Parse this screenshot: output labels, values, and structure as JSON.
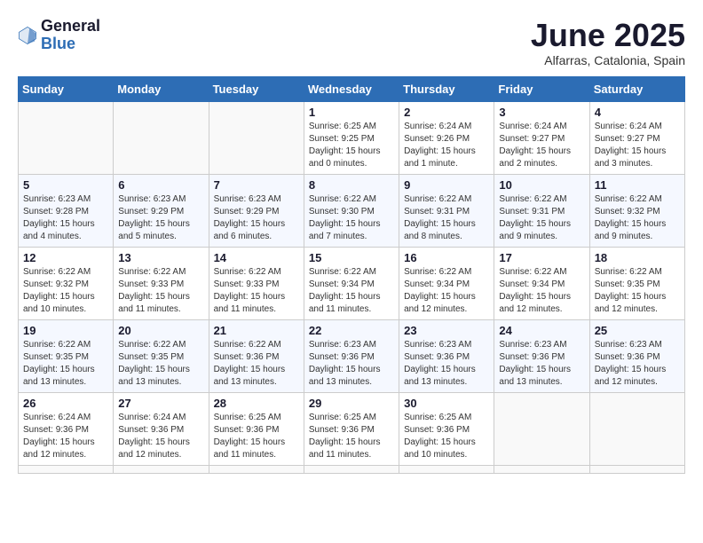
{
  "logo": {
    "general": "General",
    "blue": "Blue"
  },
  "header": {
    "month": "June 2025",
    "location": "Alfarras, Catalonia, Spain"
  },
  "weekdays": [
    "Sunday",
    "Monday",
    "Tuesday",
    "Wednesday",
    "Thursday",
    "Friday",
    "Saturday"
  ],
  "days": [
    {
      "num": "",
      "sunrise": "",
      "sunset": "",
      "daylight": ""
    },
    {
      "num": "",
      "sunrise": "",
      "sunset": "",
      "daylight": ""
    },
    {
      "num": "",
      "sunrise": "",
      "sunset": "",
      "daylight": ""
    },
    {
      "num": "1",
      "sunrise": "Sunrise: 6:25 AM",
      "sunset": "Sunset: 9:25 PM",
      "daylight": "Daylight: 15 hours and 0 minutes."
    },
    {
      "num": "2",
      "sunrise": "Sunrise: 6:24 AM",
      "sunset": "Sunset: 9:26 PM",
      "daylight": "Daylight: 15 hours and 1 minute."
    },
    {
      "num": "3",
      "sunrise": "Sunrise: 6:24 AM",
      "sunset": "Sunset: 9:27 PM",
      "daylight": "Daylight: 15 hours and 2 minutes."
    },
    {
      "num": "4",
      "sunrise": "Sunrise: 6:24 AM",
      "sunset": "Sunset: 9:27 PM",
      "daylight": "Daylight: 15 hours and 3 minutes."
    },
    {
      "num": "5",
      "sunrise": "Sunrise: 6:23 AM",
      "sunset": "Sunset: 9:28 PM",
      "daylight": "Daylight: 15 hours and 4 minutes."
    },
    {
      "num": "6",
      "sunrise": "Sunrise: 6:23 AM",
      "sunset": "Sunset: 9:29 PM",
      "daylight": "Daylight: 15 hours and 5 minutes."
    },
    {
      "num": "7",
      "sunrise": "Sunrise: 6:23 AM",
      "sunset": "Sunset: 9:29 PM",
      "daylight": "Daylight: 15 hours and 6 minutes."
    },
    {
      "num": "8",
      "sunrise": "Sunrise: 6:22 AM",
      "sunset": "Sunset: 9:30 PM",
      "daylight": "Daylight: 15 hours and 7 minutes."
    },
    {
      "num": "9",
      "sunrise": "Sunrise: 6:22 AM",
      "sunset": "Sunset: 9:31 PM",
      "daylight": "Daylight: 15 hours and 8 minutes."
    },
    {
      "num": "10",
      "sunrise": "Sunrise: 6:22 AM",
      "sunset": "Sunset: 9:31 PM",
      "daylight": "Daylight: 15 hours and 9 minutes."
    },
    {
      "num": "11",
      "sunrise": "Sunrise: 6:22 AM",
      "sunset": "Sunset: 9:32 PM",
      "daylight": "Daylight: 15 hours and 9 minutes."
    },
    {
      "num": "12",
      "sunrise": "Sunrise: 6:22 AM",
      "sunset": "Sunset: 9:32 PM",
      "daylight": "Daylight: 15 hours and 10 minutes."
    },
    {
      "num": "13",
      "sunrise": "Sunrise: 6:22 AM",
      "sunset": "Sunset: 9:33 PM",
      "daylight": "Daylight: 15 hours and 11 minutes."
    },
    {
      "num": "14",
      "sunrise": "Sunrise: 6:22 AM",
      "sunset": "Sunset: 9:33 PM",
      "daylight": "Daylight: 15 hours and 11 minutes."
    },
    {
      "num": "15",
      "sunrise": "Sunrise: 6:22 AM",
      "sunset": "Sunset: 9:34 PM",
      "daylight": "Daylight: 15 hours and 11 minutes."
    },
    {
      "num": "16",
      "sunrise": "Sunrise: 6:22 AM",
      "sunset": "Sunset: 9:34 PM",
      "daylight": "Daylight: 15 hours and 12 minutes."
    },
    {
      "num": "17",
      "sunrise": "Sunrise: 6:22 AM",
      "sunset": "Sunset: 9:34 PM",
      "daylight": "Daylight: 15 hours and 12 minutes."
    },
    {
      "num": "18",
      "sunrise": "Sunrise: 6:22 AM",
      "sunset": "Sunset: 9:35 PM",
      "daylight": "Daylight: 15 hours and 12 minutes."
    },
    {
      "num": "19",
      "sunrise": "Sunrise: 6:22 AM",
      "sunset": "Sunset: 9:35 PM",
      "daylight": "Daylight: 15 hours and 13 minutes."
    },
    {
      "num": "20",
      "sunrise": "Sunrise: 6:22 AM",
      "sunset": "Sunset: 9:35 PM",
      "daylight": "Daylight: 15 hours and 13 minutes."
    },
    {
      "num": "21",
      "sunrise": "Sunrise: 6:22 AM",
      "sunset": "Sunset: 9:36 PM",
      "daylight": "Daylight: 15 hours and 13 minutes."
    },
    {
      "num": "22",
      "sunrise": "Sunrise: 6:23 AM",
      "sunset": "Sunset: 9:36 PM",
      "daylight": "Daylight: 15 hours and 13 minutes."
    },
    {
      "num": "23",
      "sunrise": "Sunrise: 6:23 AM",
      "sunset": "Sunset: 9:36 PM",
      "daylight": "Daylight: 15 hours and 13 minutes."
    },
    {
      "num": "24",
      "sunrise": "Sunrise: 6:23 AM",
      "sunset": "Sunset: 9:36 PM",
      "daylight": "Daylight: 15 hours and 13 minutes."
    },
    {
      "num": "25",
      "sunrise": "Sunrise: 6:23 AM",
      "sunset": "Sunset: 9:36 PM",
      "daylight": "Daylight: 15 hours and 12 minutes."
    },
    {
      "num": "26",
      "sunrise": "Sunrise: 6:24 AM",
      "sunset": "Sunset: 9:36 PM",
      "daylight": "Daylight: 15 hours and 12 minutes."
    },
    {
      "num": "27",
      "sunrise": "Sunrise: 6:24 AM",
      "sunset": "Sunset: 9:36 PM",
      "daylight": "Daylight: 15 hours and 12 minutes."
    },
    {
      "num": "28",
      "sunrise": "Sunrise: 6:25 AM",
      "sunset": "Sunset: 9:36 PM",
      "daylight": "Daylight: 15 hours and 11 minutes."
    },
    {
      "num": "29",
      "sunrise": "Sunrise: 6:25 AM",
      "sunset": "Sunset: 9:36 PM",
      "daylight": "Daylight: 15 hours and 11 minutes."
    },
    {
      "num": "30",
      "sunrise": "Sunrise: 6:25 AM",
      "sunset": "Sunset: 9:36 PM",
      "daylight": "Daylight: 15 hours and 10 minutes."
    },
    {
      "num": "",
      "sunrise": "",
      "sunset": "",
      "daylight": ""
    },
    {
      "num": "",
      "sunrise": "",
      "sunset": "",
      "daylight": ""
    },
    {
      "num": "",
      "sunrise": "",
      "sunset": "",
      "daylight": ""
    },
    {
      "num": "",
      "sunrise": "",
      "sunset": "",
      "daylight": ""
    },
    {
      "num": "",
      "sunrise": "",
      "sunset": "",
      "daylight": ""
    }
  ]
}
